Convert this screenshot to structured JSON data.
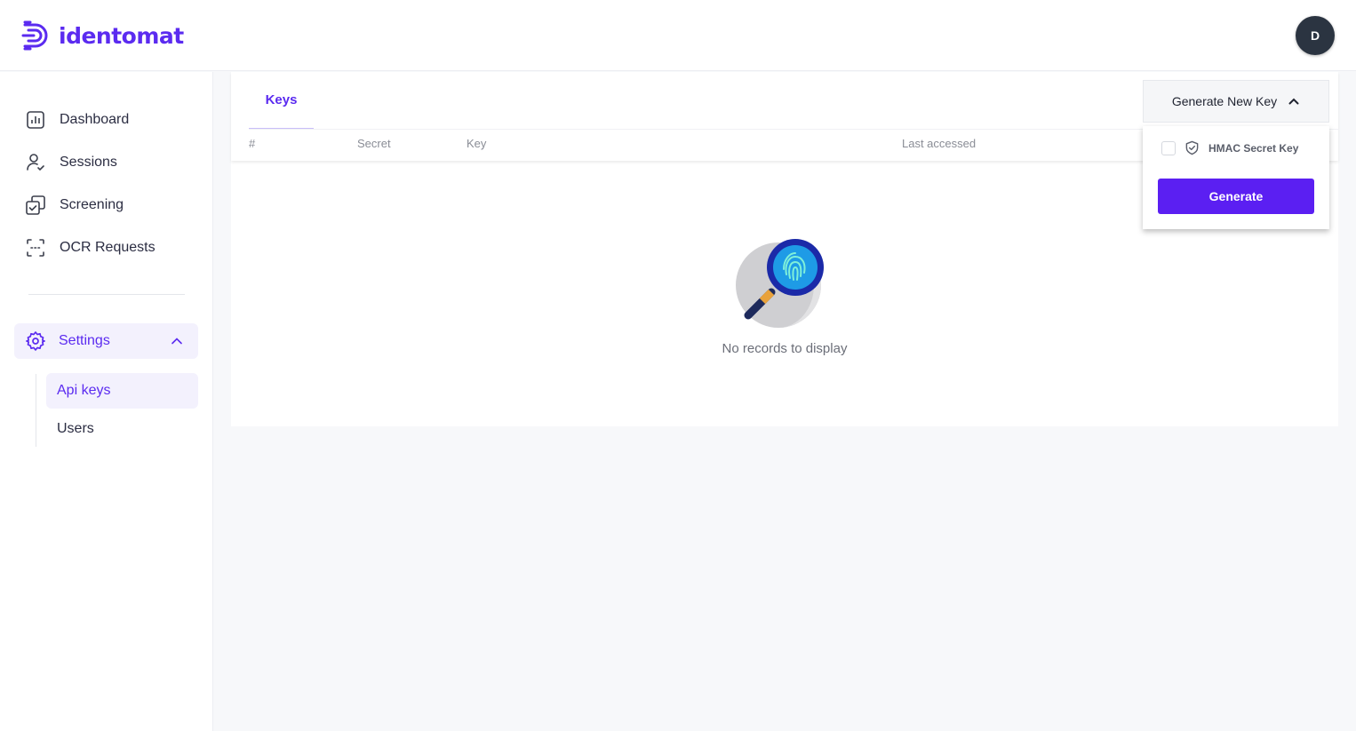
{
  "header": {
    "logo_text": "identomat",
    "avatar_initial": "D"
  },
  "sidebar": {
    "items": [
      {
        "label": "Dashboard",
        "icon": "bar-chart-icon"
      },
      {
        "label": "Sessions",
        "icon": "user-check-icon"
      },
      {
        "label": "Screening",
        "icon": "copy-check-icon"
      },
      {
        "label": "OCR Requests",
        "icon": "scan-frame-icon"
      }
    ],
    "settings": {
      "label": "Settings",
      "icon": "gear-icon",
      "expanded": true
    },
    "sub_items": [
      {
        "label": "Api keys",
        "active": true
      },
      {
        "label": "Users",
        "active": false
      }
    ]
  },
  "main": {
    "tab_label": "Keys",
    "columns": [
      "#",
      "Secret",
      "Key",
      "Last accessed"
    ],
    "empty_text": "No records to display"
  },
  "dropdown": {
    "button_label": "Generate New Key",
    "option_label": "HMAC Secret Key",
    "option_checked": false,
    "generate_label": "Generate"
  },
  "colors": {
    "accent": "#5b2bf0",
    "button": "#5b1ff2",
    "avatar": "#2b3441"
  }
}
